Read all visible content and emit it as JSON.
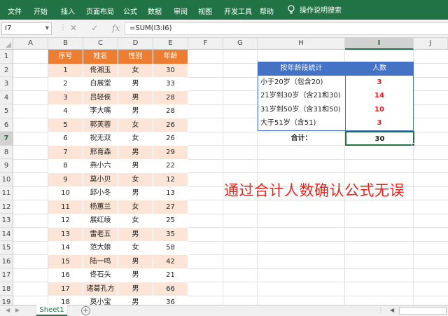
{
  "ribbon": {
    "tabs": [
      "文件",
      "开始",
      "插入",
      "页面布局",
      "公式",
      "数据",
      "审阅",
      "视图",
      "开发工具",
      "帮助"
    ],
    "tell_me": "操作说明搜索",
    "color": "#217346"
  },
  "formula_bar": {
    "name_box": "I7",
    "cancel_icon": "✕",
    "enter_icon": "✓",
    "fx_label": "fx",
    "formula": "=SUM(I3:I6)"
  },
  "columns": [
    "A",
    "B",
    "C",
    "D",
    "E",
    "F",
    "G",
    "H",
    "I",
    "J"
  ],
  "selected_column": "I",
  "rows": [
    "1",
    "2",
    "3",
    "4",
    "5",
    "6",
    "7",
    "8",
    "9",
    "10",
    "11",
    "12",
    "13",
    "14",
    "15",
    "16",
    "17",
    "18",
    "19"
  ],
  "selected_row": "7",
  "main_table": {
    "headers": [
      "序号",
      "姓名",
      "性别",
      "年龄"
    ],
    "header_color": "#ed7d31",
    "band_color": "#fce4d6",
    "rows": [
      [
        "1",
        "佟湘玉",
        "女",
        "30"
      ],
      [
        "2",
        "白展堂",
        "男",
        "33"
      ],
      [
        "3",
        "吕轻侯",
        "男",
        "28"
      ],
      [
        "4",
        "李大嘴",
        "男",
        "28"
      ],
      [
        "5",
        "郭芙蓉",
        "女",
        "26"
      ],
      [
        "6",
        "祝无双",
        "女",
        "26"
      ],
      [
        "7",
        "邢育森",
        "男",
        "29"
      ],
      [
        "8",
        "燕小六",
        "男",
        "22"
      ],
      [
        "9",
        "莫小贝",
        "女",
        "12"
      ],
      [
        "10",
        "邱小冬",
        "男",
        "13"
      ],
      [
        "11",
        "杨蕙兰",
        "女",
        "27"
      ],
      [
        "12",
        "展红绫",
        "女",
        "25"
      ],
      [
        "13",
        "雷老五",
        "男",
        "35"
      ],
      [
        "14",
        "范大娘",
        "女",
        "58"
      ],
      [
        "15",
        "陆一鸣",
        "男",
        "42"
      ],
      [
        "16",
        "佟石头",
        "男",
        "21"
      ],
      [
        "17",
        "诸葛孔方",
        "男",
        "66"
      ],
      [
        "18",
        "莫小宝",
        "男",
        "36"
      ]
    ]
  },
  "summary_table": {
    "header_label": "按年龄段统计",
    "header_value": "人数",
    "header_color": "#4472c4",
    "rows": [
      {
        "label": "小于20岁（包含20)",
        "value": "3"
      },
      {
        "label": "21岁到30岁（含21和30)",
        "value": "14"
      },
      {
        "label": "31岁到50岁（含31和50)",
        "value": "10"
      },
      {
        "label": "大于51岁（含51)",
        "value": "3"
      }
    ],
    "total_label": "合计：",
    "total_value": "30",
    "value_color": "#e02020"
  },
  "annotation": "通过合计人数确认公式无误",
  "sheet_tabs": [
    "Sheet1"
  ],
  "add_sheet_symbol": "+"
}
